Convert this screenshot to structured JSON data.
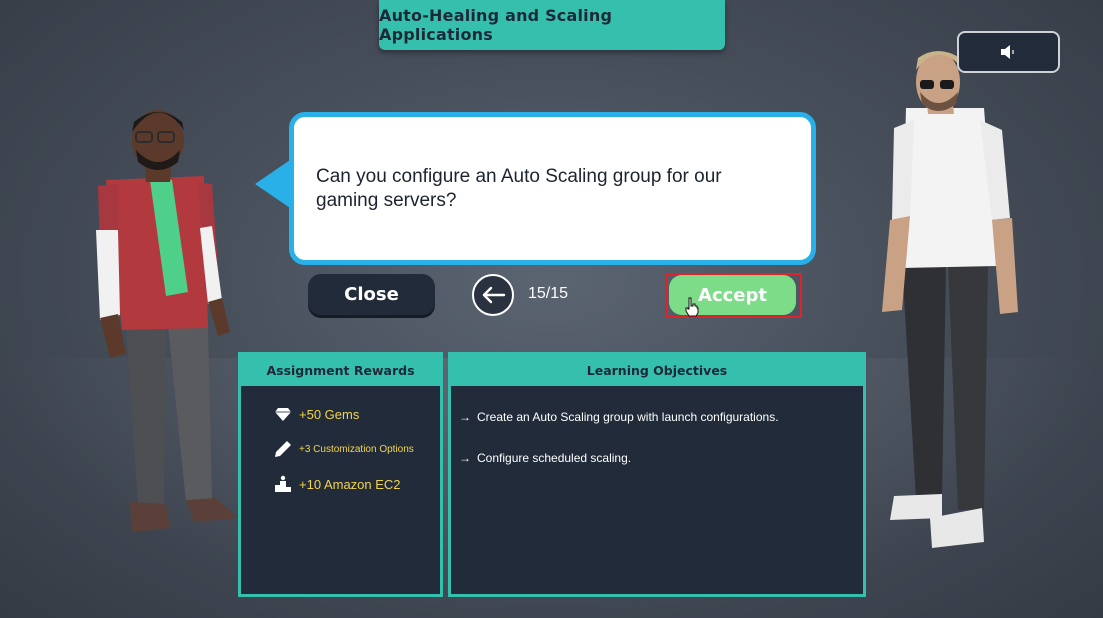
{
  "title": "Auto-Healing and Scaling Applications",
  "sound_button": {
    "icon": "speaker-icon"
  },
  "dialog": {
    "text": "Can you configure an Auto Scaling group for our gaming servers?"
  },
  "controls": {
    "close_label": "Close",
    "back_icon": "arrow-left-icon",
    "page_counter": "15/15",
    "accept_label": "Accept"
  },
  "rewards_panel": {
    "header": "Assignment Rewards",
    "items": [
      {
        "icon": "gem-icon",
        "label": "+50 Gems"
      },
      {
        "icon": "pencil-icon",
        "label": "+3 Customization Options"
      },
      {
        "icon": "podium-icon",
        "label": "+10 Amazon EC2"
      }
    ]
  },
  "objectives_panel": {
    "header": "Learning Objectives",
    "items": [
      {
        "arrow": "→",
        "text": "Create an Auto Scaling group with launch configurations."
      },
      {
        "arrow": "→",
        "text": "Configure scheduled scaling."
      }
    ]
  },
  "colors": {
    "teal_accent": "#35c0ae",
    "bubble_border": "#2ab0e8",
    "panel_bg": "#222b3a",
    "accept_green": "#7ddc87",
    "reward_yellow": "#f1d44a",
    "highlight_red": "#e0222a"
  }
}
